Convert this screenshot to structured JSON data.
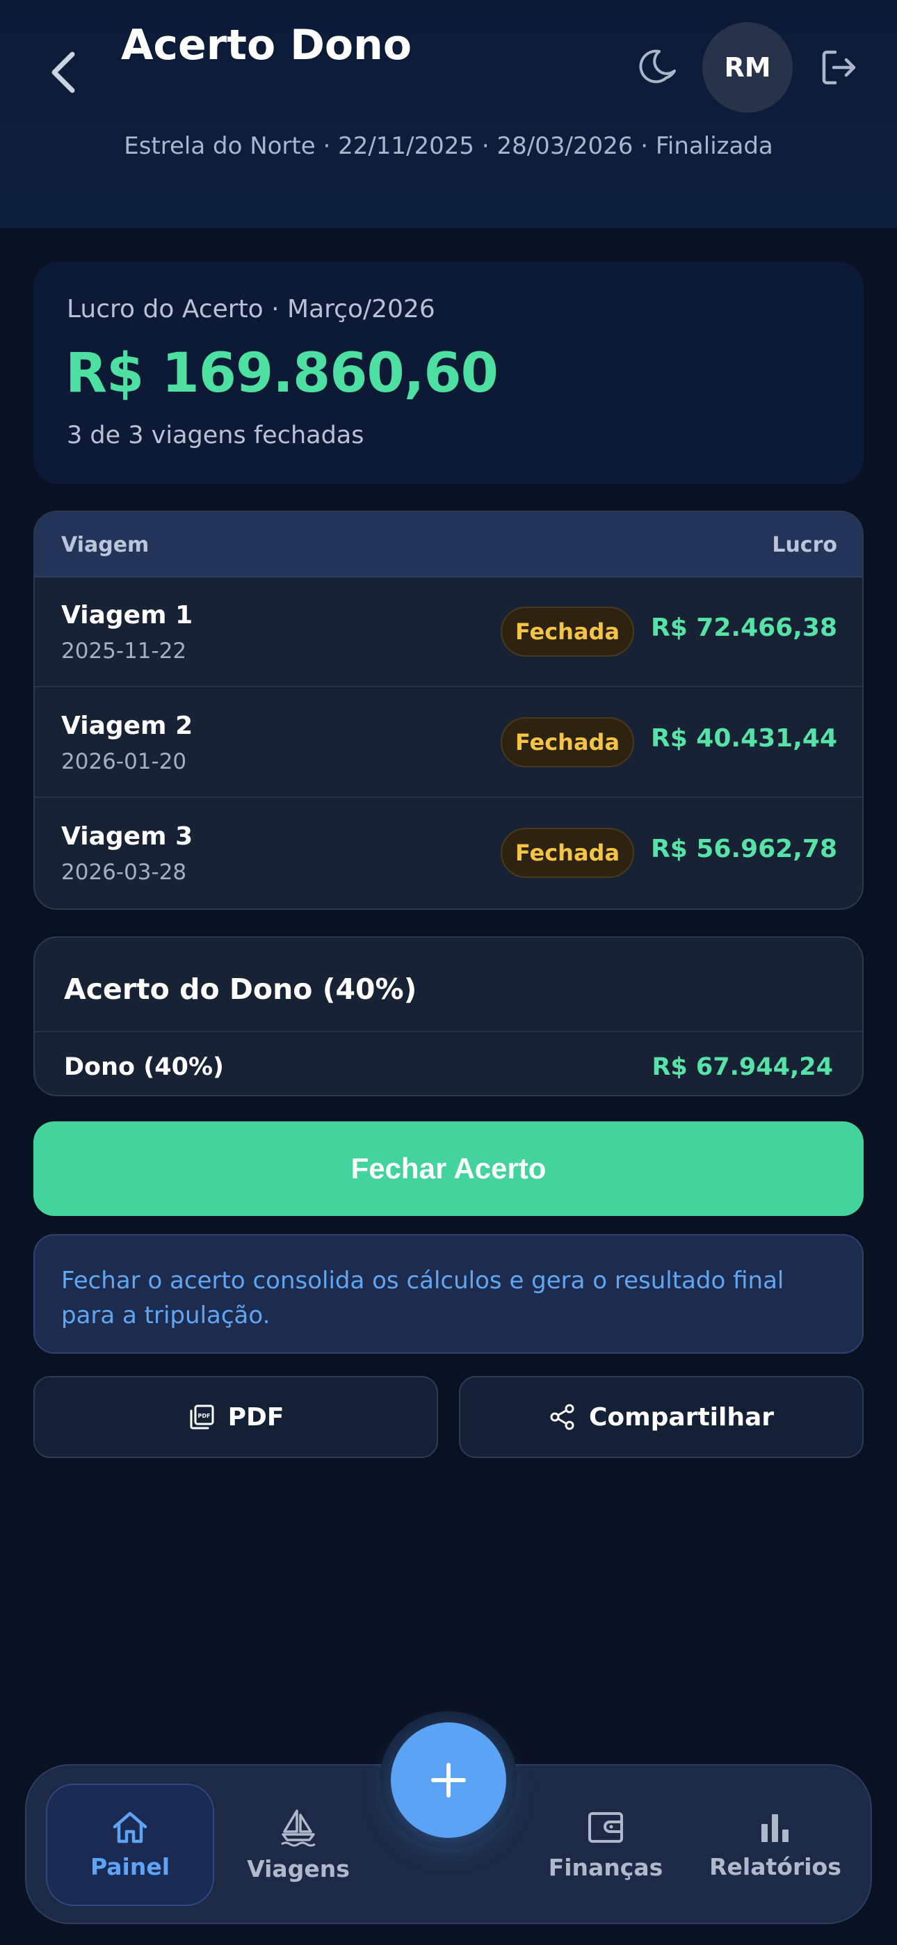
{
  "header": {
    "title": "Acerto Dono",
    "subtitle": "Estrela do Norte · 22/11/2025 · 28/03/2026 · Finalizada",
    "avatar_initials": "RM"
  },
  "summary": {
    "label": "Lucro do Acerto · Março/2026",
    "value": "R$ 169.860,60",
    "sub": "3 de 3 viagens fechadas"
  },
  "trips": {
    "col_trip": "Viagem",
    "col_profit": "Lucro",
    "rows": [
      {
        "name": "Viagem 1",
        "date": "2025-11-22",
        "status": "Fechada",
        "profit": "R$ 72.466,38"
      },
      {
        "name": "Viagem 2",
        "date": "2026-01-20",
        "status": "Fechada",
        "profit": "R$ 40.431,44"
      },
      {
        "name": "Viagem 3",
        "date": "2026-03-28",
        "status": "Fechada",
        "profit": "R$ 56.962,78"
      }
    ]
  },
  "owner": {
    "title": "Acerto do Dono (40%)",
    "label": "Dono (40%)",
    "value": "R$ 67.944,24"
  },
  "actions": {
    "close_label": "Fechar Acerto",
    "info_text": "Fechar o acerto consolida os cálculos e gera o resultado final para a tripulação.",
    "pdf_label": "PDF",
    "share_label": "Compartilhar"
  },
  "nav": {
    "items": [
      {
        "label": "Painel",
        "icon": "home-icon"
      },
      {
        "label": "Viagens",
        "icon": "sailboat-icon"
      },
      {
        "label": "Finanças",
        "icon": "wallet-icon"
      },
      {
        "label": "Relatórios",
        "icon": "bar-chart-icon"
      }
    ]
  },
  "colors": {
    "accent_green": "#42d49c",
    "profit_green": "#55e3a8",
    "accent_blue": "#5aa3f5",
    "badge_yellow": "#f6c444"
  }
}
